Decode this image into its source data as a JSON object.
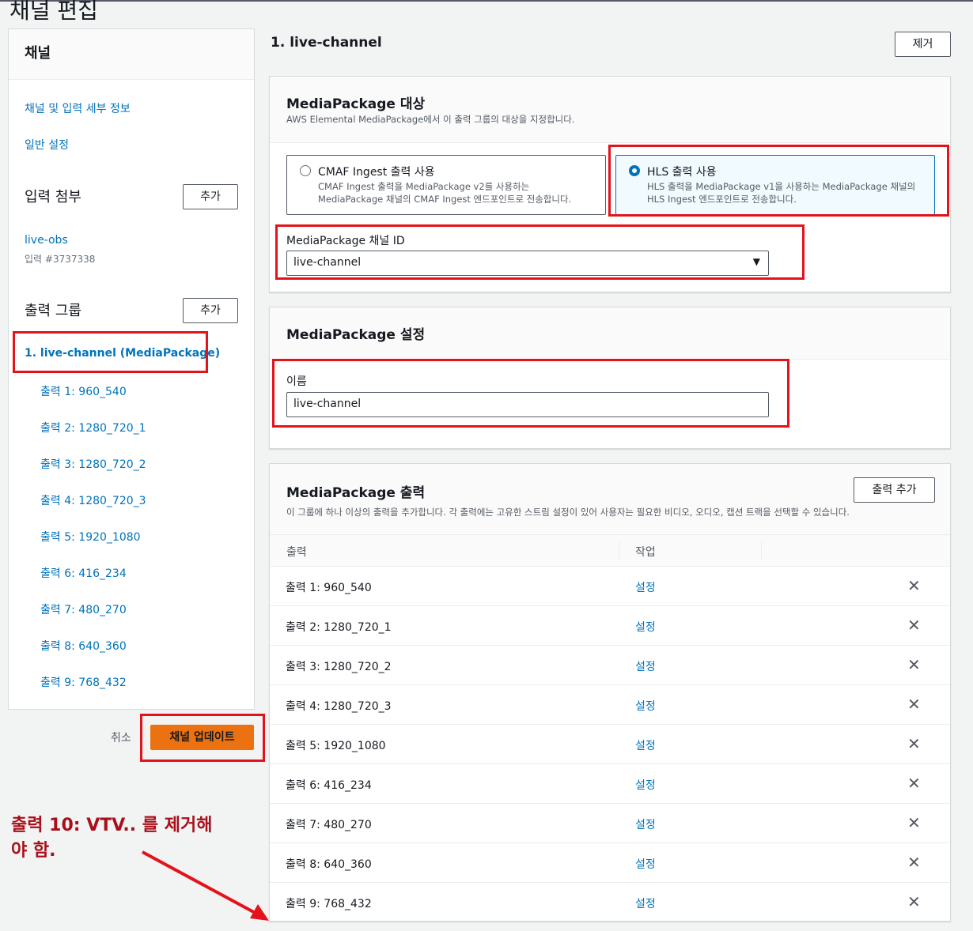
{
  "page": {
    "title": "채널 편집"
  },
  "sidebar": {
    "header": "채널",
    "links": [
      "채널 및 입력 세부 정보",
      "일반 설정"
    ],
    "input_attach": {
      "label": "입력 첨부",
      "add": "추가"
    },
    "input": {
      "name": "live-obs",
      "id": "입력 #3737338"
    },
    "output_groups": {
      "label": "출력 그룹",
      "add": "추가"
    },
    "group": "1. live-channel (MediaPackage)",
    "outputs": [
      "출력 1: 960_540",
      "출력 2: 1280_720_1",
      "출력 3: 1280_720_2",
      "출력 4: 1280_720_3",
      "출력 5: 1920_1080",
      "출력 6: 416_234",
      "출력 7: 480_270",
      "출력 8: 640_360",
      "출력 9: 768_432"
    ]
  },
  "footer": {
    "cancel": "취소",
    "update": "채널 업데이트"
  },
  "annotation": {
    "line1": "출력 10: VTV.. 를 제거해",
    "line2": "야 함."
  },
  "main": {
    "group_title": "1. live-channel",
    "remove": "제거",
    "destination": {
      "title": "MediaPackage 대상",
      "desc": "AWS Elemental MediaPackage에서 이 출력 그룹의 대상을 지정합니다.",
      "option_cmaf": {
        "label": "CMAF Ingest 출력 사용",
        "desc1": "CMAF Ingest 출력을 MediaPackage v2를 사용하는",
        "desc2": "MediaPackage 채널의 CMAF Ingest 엔드포인트로 전송합니다."
      },
      "option_hls": {
        "label": "HLS 출력 사용",
        "desc1": "HLS 출력을 MediaPackage v1을 사용하는 MediaPackage 채널의",
        "desc2": "HLS Ingest 엔드포인트로 전송합니다."
      },
      "channel_id_label": "MediaPackage 채널 ID",
      "channel_id_value": "live-channel"
    },
    "settings": {
      "title": "MediaPackage 설정",
      "name_label": "이름",
      "name_value": "live-channel"
    },
    "outputs": {
      "title": "MediaPackage 출력",
      "add": "출력 추가",
      "desc": "이 그룹에 하나 이상의 출력을 추가합니다. 각 출력에는 고유한 스트림 설정이 있어 사용자는 필요한 비디오, 오디오, 캡션 트랙을 선택할 수 있습니다.",
      "col_output": "출력",
      "col_action": "작업",
      "action": "설정",
      "rows": [
        "출력 1: 960_540",
        "출력 2: 1280_720_1",
        "출력 3: 1280_720_2",
        "출력 4: 1280_720_3",
        "출력 5: 1920_1080",
        "출력 6: 416_234",
        "출력 7: 480_270",
        "출력 8: 640_360",
        "출력 9: 768_432"
      ]
    }
  },
  "colors": {
    "accent": "#0073bb",
    "primary_button": "#ec7211",
    "highlight": "#e4131b",
    "annotation": "#a80f1a"
  }
}
